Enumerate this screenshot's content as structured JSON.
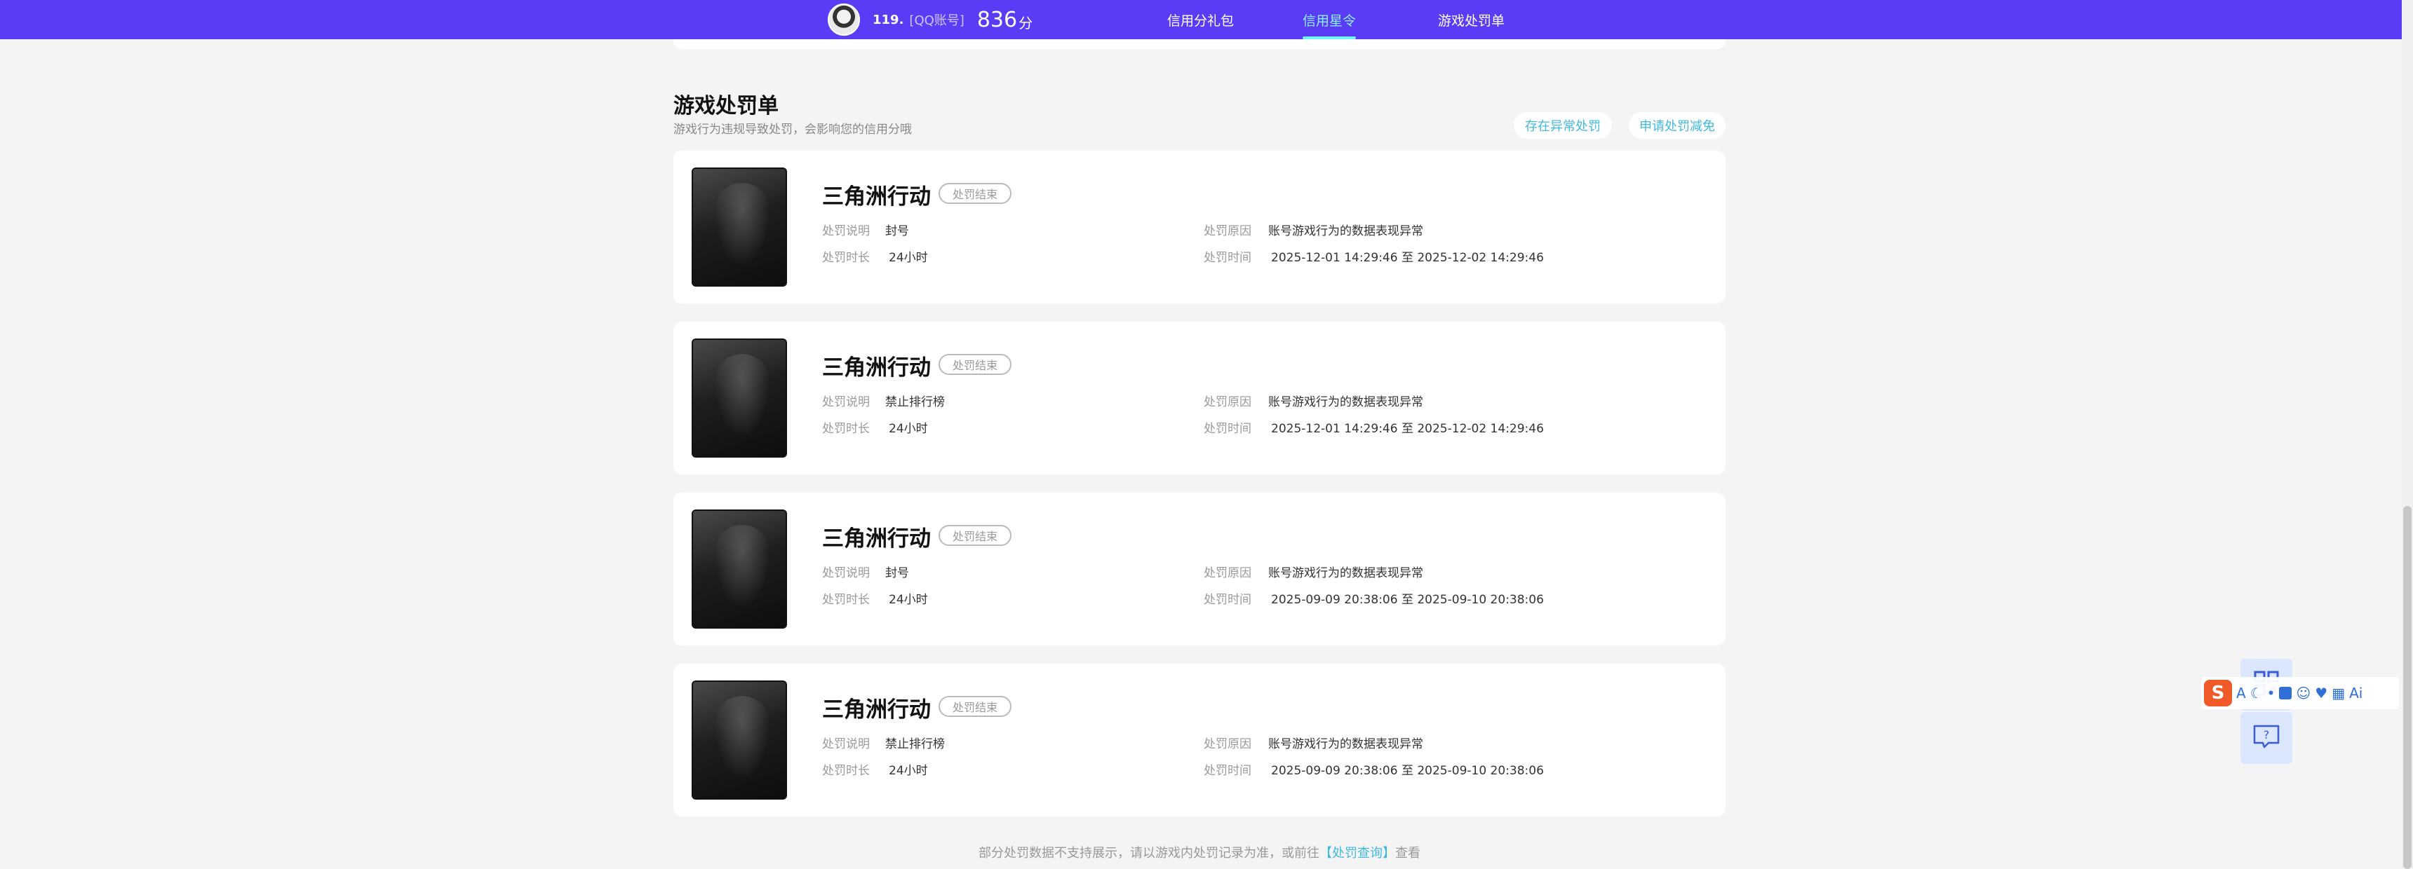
{
  "header": {
    "user_name": "119.",
    "account_type": "[QQ账号]",
    "score": "836",
    "score_unit": "分",
    "nav": [
      {
        "label": "信用分礼包",
        "active": false
      },
      {
        "label": "信用星令",
        "active": true
      },
      {
        "label": "游戏处罚单",
        "active": false
      }
    ]
  },
  "section": {
    "title": "游戏处罚单",
    "subtitle": "游戏行为违规导致处罚，会影响您的信用分哦",
    "actions": {
      "abnormal": "存在异常处罚",
      "reduce": "申请处罚减免"
    }
  },
  "labels": {
    "desc": "处罚说明",
    "duration": "处罚时长",
    "reason": "处罚原因",
    "time": "处罚时间"
  },
  "records": [
    {
      "game": "三角洲行动",
      "status": "处罚结束",
      "desc": "封号",
      "duration": "24小时",
      "reason": "账号游戏行为的数据表现异常",
      "time": "2025-12-01 14:29:46 至 2025-12-02 14:29:46"
    },
    {
      "game": "三角洲行动",
      "status": "处罚结束",
      "desc": "禁止排行榜",
      "duration": "24小时",
      "reason": "账号游戏行为的数据表现异常",
      "time": "2025-12-01 14:29:46 至 2025-12-02 14:29:46"
    },
    {
      "game": "三角洲行动",
      "status": "处罚结束",
      "desc": "封号",
      "duration": "24小时",
      "reason": "账号游戏行为的数据表现异常",
      "time": "2025-09-09 20:38:06 至 2025-09-10 20:38:06"
    },
    {
      "game": "三角洲行动",
      "status": "处罚结束",
      "desc": "禁止排行榜",
      "duration": "24小时",
      "reason": "账号游戏行为的数据表现异常",
      "time": "2025-09-09 20:38:06 至 2025-09-10 20:38:06"
    }
  ],
  "footer": {
    "prefix": "部分处罚数据不支持展示，请以游戏内处罚记录为准，或前往",
    "link": "【处罚查询】",
    "suffix": "查看"
  },
  "ime": {
    "logo": "S",
    "lang": "A",
    "ai": "Ai"
  },
  "icons": {
    "qr": "qr-code-icon",
    "help": "help-question-icon"
  }
}
